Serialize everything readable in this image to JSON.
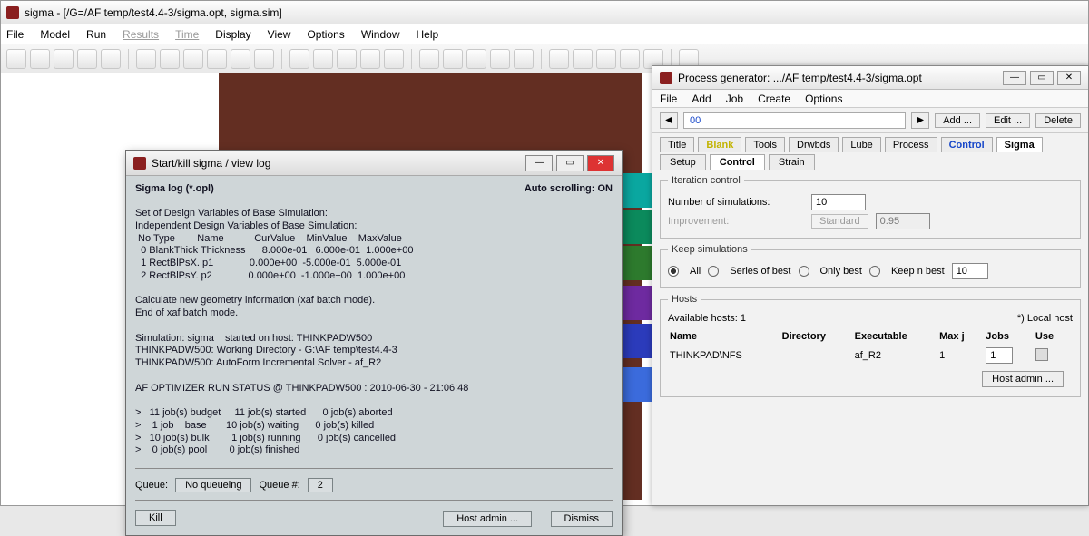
{
  "main": {
    "title": "sigma - [/G=/AF temp/test4.4-3/sigma.opt, sigma.sim]",
    "menus": [
      "File",
      "Model",
      "Run",
      "Results",
      "Time",
      "Display",
      "View",
      "Options",
      "Window",
      "Help"
    ]
  },
  "log": {
    "title": "Start/kill sigma / view log",
    "header_left": "Sigma log (*.opl)",
    "header_right": "Auto scrolling: ON",
    "body": "Set of Design Variables of Base Simulation:\nIndependent Design Variables of Base Simulation:\n No Type        Name           CurValue    MinValue    MaxValue\n  0 BlankThick Thickness      8.000e-01   6.000e-01  1.000e+00\n  1 RectBlPsX. p1             0.000e+00  -5.000e-01  5.000e-01\n  2 RectBlPsY. p2             0.000e+00  -1.000e+00  1.000e+00\n\nCalculate new geometry information (xaf batch mode).\nEnd of xaf batch mode.\n\nSimulation: sigma    started on host: THINKPADW500\nTHINKPADW500: Working Directory - G:\\AF temp\\test4.4-3\nTHINKPADW500: AutoForm Incremental Solver - af_R2\n\nAF OPTIMIZER RUN STATUS @ THINKPADW500 : 2010-06-30 - 21:06:48\n\n>   11 job(s) budget     11 job(s) started      0 job(s) aborted\n>    1 job    base       10 job(s) waiting      0 job(s) killed\n>   10 job(s) bulk        1 job(s) running      0 job(s) cancelled\n>    0 job(s) pool        0 job(s) finished",
    "queue_label": "Queue:",
    "queue_mode": "No queueing",
    "queue_num_label": "Queue #:",
    "queue_num": "2",
    "btn_kill": "Kill",
    "btn_hostadmin": "Host admin ...",
    "btn_dismiss": "Dismiss"
  },
  "pg": {
    "title": "Process generator: .../AF temp/test4.4-3/sigma.opt",
    "menus": [
      "File",
      "Add",
      "Job",
      "Create",
      "Options"
    ],
    "nav_value": "00",
    "btn_add": "Add ...",
    "btn_edit": "Edit ...",
    "btn_delete": "Delete",
    "tabs": [
      "Title",
      "Blank",
      "Tools",
      "Drwbds",
      "Lube",
      "Process",
      "Control",
      "Sigma"
    ],
    "subtabs": [
      "Setup",
      "Control",
      "Strain"
    ],
    "iter_legend": "Iteration control",
    "iter_nsim_label": "Number of simulations:",
    "iter_nsim": "10",
    "iter_improv_label": "Improvement:",
    "iter_improv_mode": "Standard",
    "iter_improv_val": "0.95",
    "keep_legend": "Keep simulations",
    "keep_all": "All",
    "keep_series": "Series of best",
    "keep_only": "Only best",
    "keep_n": "Keep n best",
    "keep_n_val": "10",
    "hosts_legend": "Hosts",
    "hosts_avail_label": "Available hosts: 1",
    "hosts_local_note": "*) Local host",
    "hosts_cols": {
      "name": "Name",
      "dir": "Directory",
      "exe": "Executable",
      "maxj": "Max j",
      "jobs": "Jobs",
      "use": "Use"
    },
    "host_row": {
      "name": "THINKPAD\\NFS",
      "exe": "af_R2",
      "maxj": "1",
      "jobs": "1"
    },
    "btn_hostadmin": "Host admin ..."
  }
}
